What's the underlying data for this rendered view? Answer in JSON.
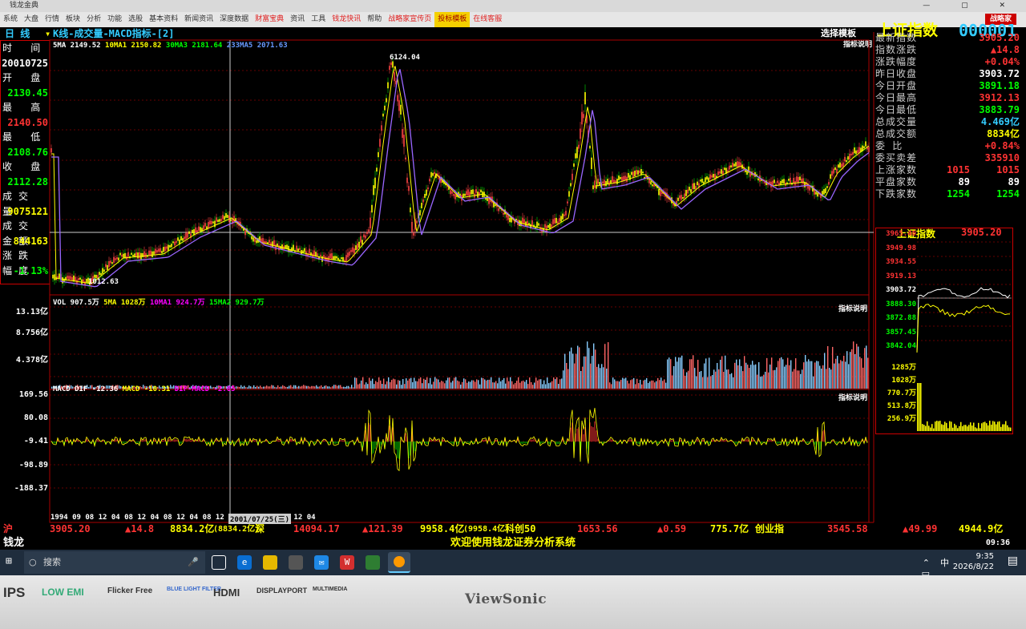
{
  "window": {
    "title": "钱龙金典"
  },
  "menu": {
    "items": [
      "系统",
      "大盘",
      "行情",
      "板块",
      "分析",
      "功能",
      "选股",
      "基本资料",
      "新闻资讯",
      "深度数据",
      "财富宝典",
      "资讯",
      "工具",
      "钱龙快讯",
      "帮助",
      "战略家宣传页",
      "投标模板",
      "在线客服"
    ],
    "brand": "战略家"
  },
  "tabs": {
    "period": "日 线",
    "title": "K线-成交量-MACD指标-[2]"
  },
  "stock": {
    "name": "上证指数",
    "code": "000001",
    "template": "选择模板",
    "indicator": "指标说明"
  },
  "left_panel": {
    "rows": [
      {
        "label": "时 间",
        "value": "20010725"
      },
      {
        "label": "开 盘",
        "value": "2130.45"
      },
      {
        "label": "最 高",
        "value": "2140.50"
      },
      {
        "label": "最 低",
        "value": "2108.76"
      },
      {
        "label": "收 盘",
        "value": "2112.28"
      },
      {
        "label": "成交量",
        "value": "9075121"
      },
      {
        "label": "成交金额",
        "value": "844163"
      },
      {
        "label": "涨跌幅度",
        "value": "-1.13%"
      }
    ]
  },
  "kline": {
    "legend": {
      "ma5": "5MA 2149.52",
      "ma10": "10MA1 2150.82",
      "ma30": "30MA3 2181.64",
      "ma233": "233MA5 2071.63"
    },
    "peak_label": "6124.04",
    "low_label": "1012.63",
    "bottom_axis": "1012.63"
  },
  "volume": {
    "legend": {
      "vol": "VOL 907.5万",
      "ma5": "5MA 1028万",
      "ma10": "10MA1 924.7万",
      "ma15": "15MA2 929.7万"
    },
    "axis": [
      "13.13亿",
      "8.756亿",
      "4.378亿"
    ]
  },
  "macd": {
    "legend": {
      "dif": "MACD DIF -12.36",
      "macd": "MACD -10.31",
      "diff": "DIF-MACD -2.05"
    },
    "axis": [
      "169.56",
      "80.08",
      "-9.41",
      "-98.89",
      "-188.37"
    ]
  },
  "date_axis": {
    "ticks": "1994 09 08 12 04 08 12 04 08 12 04 08 12 04 08 12 04 08 12 04",
    "cursor_date": "2001/07/25(三)"
  },
  "right_info": {
    "rows": [
      {
        "label": "最新指数",
        "value": "3905.20",
        "color": "#ff3333"
      },
      {
        "label": "指数涨跌",
        "value": "▲14.8",
        "color": "#ff3333"
      },
      {
        "label": "涨跌幅度",
        "value": "+0.04%",
        "color": "#ff3333"
      },
      {
        "label": "昨日收盘",
        "value": "3903.72",
        "color": "#ffffff"
      },
      {
        "label": "今日开盘",
        "value": "3891.18",
        "color": "#00ff00"
      },
      {
        "label": "今日最高",
        "value": "3912.13",
        "color": "#ff3333"
      },
      {
        "label": "今日最低",
        "value": "3883.79",
        "color": "#00ff00"
      },
      {
        "label": "总成交量",
        "value": "4.469亿",
        "color": "#33ccff"
      },
      {
        "label": "总成交额",
        "value": "8834亿",
        "color": "#ffff00"
      },
      {
        "label": "委 比",
        "value": "+0.84%",
        "color": "#ff3333"
      },
      {
        "label": "委买卖差",
        "value": "335910",
        "color": "#ff3333"
      }
    ],
    "counts": [
      {
        "label": "上涨家数",
        "v1": "1015",
        "v2": "1015",
        "color": "#ff3333"
      },
      {
        "label": "平盘家数",
        "v1": "89",
        "v2": "89",
        "color": "#ffffff"
      },
      {
        "label": "下跌家数",
        "v1": "1254",
        "v2": "1254",
        "color": "#00ff00"
      }
    ]
  },
  "mini_chart": {
    "title": "上证指数",
    "value": "3905.20",
    "price_axis": [
      "3965.40",
      "3949.98",
      "3934.55",
      "3919.13",
      "3903.72",
      "3888.30",
      "3872.88",
      "3857.45",
      "3842.04"
    ],
    "vol_axis": [
      "1285万",
      "1028万",
      "770.7万",
      "513.8万",
      "256.9万"
    ]
  },
  "ticker": {
    "sh_label": "沪",
    "sh_value": "3905.20",
    "sh_change": "▲14.8",
    "sh_amount": "8834.2亿",
    "sh_amount2": "(8834.2亿)",
    "sz_label": "深",
    "sz_value": "14094.17",
    "sz_change": "▲121.39",
    "sz_amount": "9958.4亿",
    "sz_amount2": "(9958.4亿)",
    "kc_label": "科创50",
    "kc_value": "1653.56",
    "kc_change": "▲0.59",
    "kc_amount": "775.7亿",
    "cy_label": "创业指",
    "cy_value": "3545.58",
    "cy_change": "▲49.99",
    "cy_amount": "4944.9亿"
  },
  "welcome": {
    "app": "钱龙",
    "text": "欢迎使用钱龙证券分析系统",
    "time": "09:36"
  },
  "taskbar": {
    "search": "搜索",
    "clock": "9:35",
    "date": "2026/8/22",
    "ime": "中"
  },
  "bezel": {
    "logos": [
      "IPS",
      "LOW EMI",
      "Flicker Free",
      "BLUE LIGHT FILTER",
      "HDMI",
      "DISPLAYPORT",
      "MULTIMEDIA"
    ],
    "brand": "ViewSonic"
  }
}
